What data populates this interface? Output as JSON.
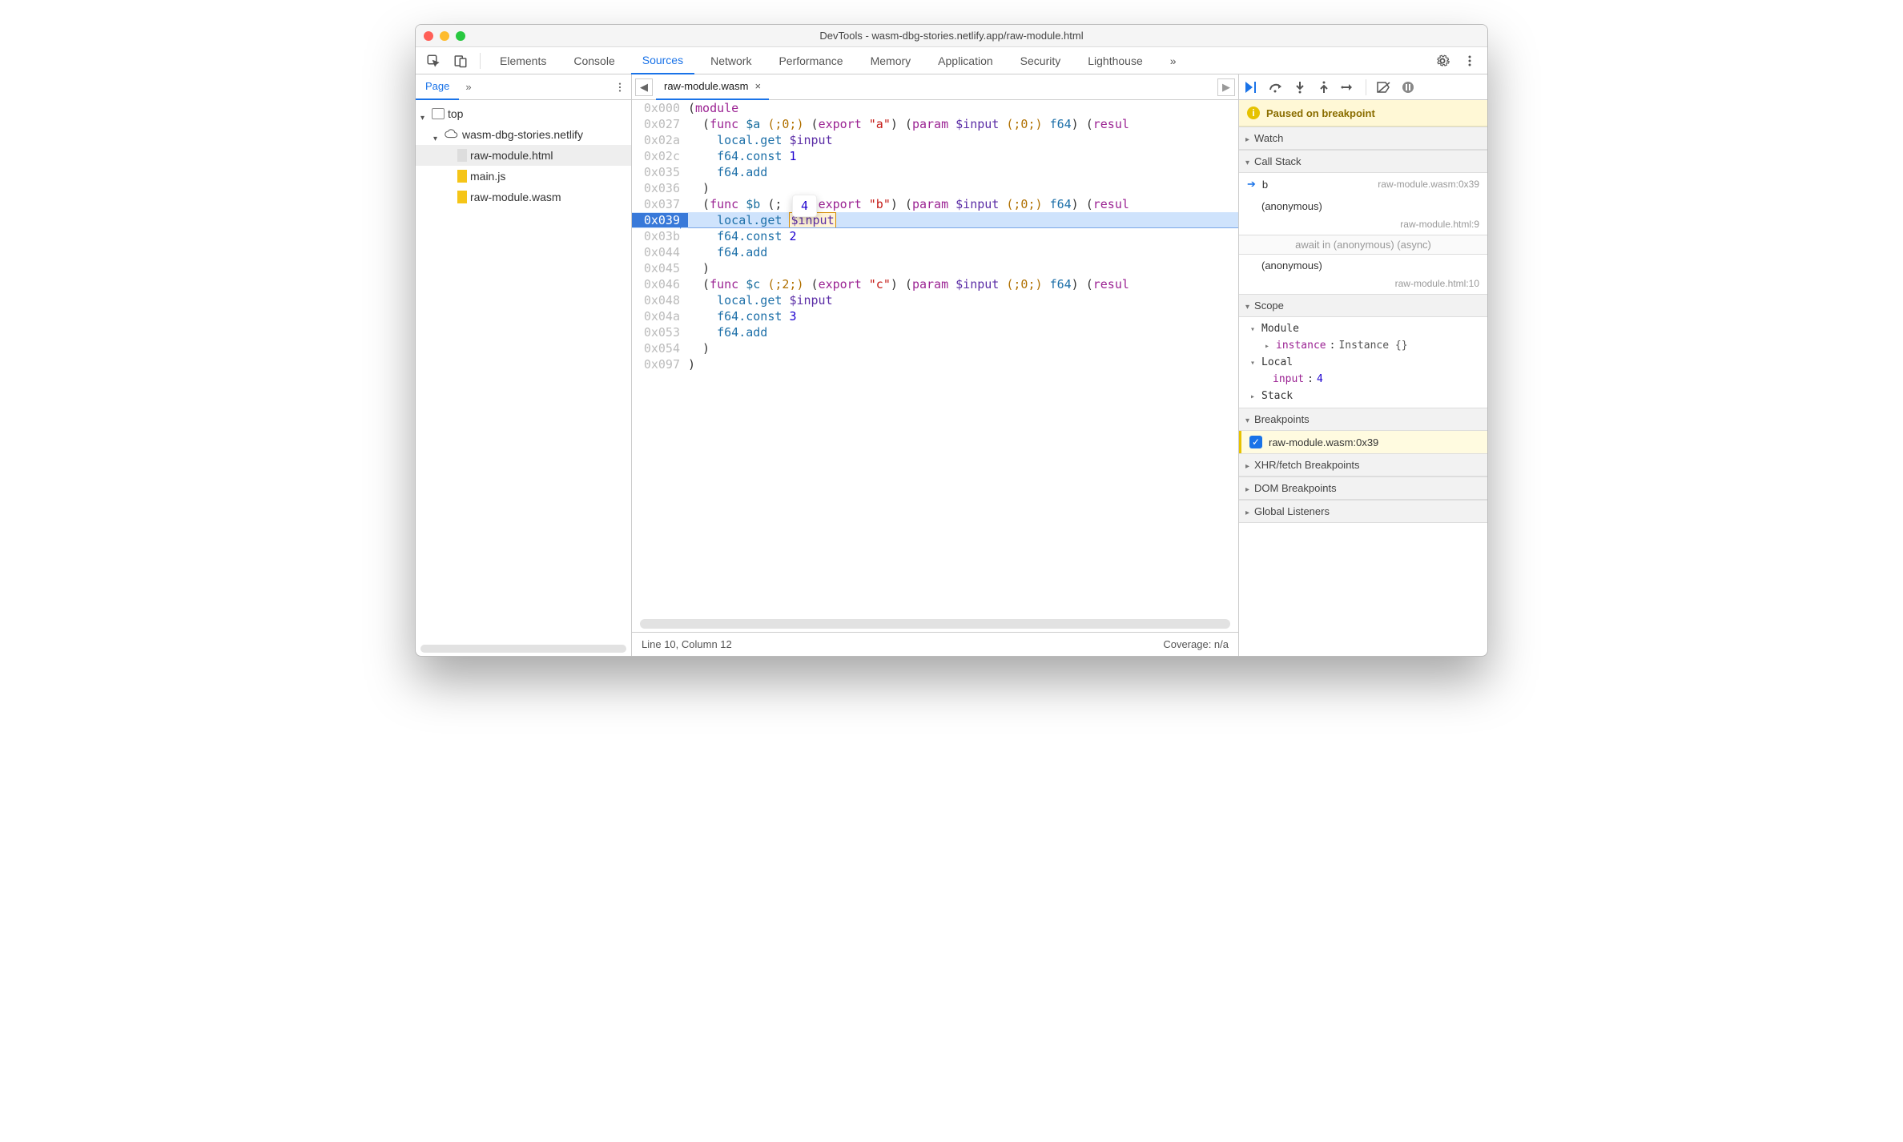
{
  "titlebar": {
    "title": "DevTools - wasm-dbg-stories.netlify.app/raw-module.html"
  },
  "tabs": {
    "items": [
      "Elements",
      "Console",
      "Sources",
      "Network",
      "Performance",
      "Memory",
      "Application",
      "Security",
      "Lighthouse"
    ],
    "more": "»",
    "active_index": 2
  },
  "page_panel": {
    "tabs": {
      "page": "Page",
      "more": "»"
    },
    "tree": {
      "top": "top",
      "origin": "wasm-dbg-stories.netlify",
      "files": [
        "raw-module.html",
        "main.js",
        "raw-module.wasm"
      ],
      "selected_index": 0
    }
  },
  "editor": {
    "tab_label": "raw-module.wasm",
    "tooltip_value": "4",
    "lines": [
      {
        "addr": "0x000",
        "html": "(<span class='kw'>module</span>"
      },
      {
        "addr": "0x027",
        "html": "  (<span class='kw'>func</span> <span class='fn'>$a</span> <span class='cm'>(;0;)</span> (<span class='kw'>export</span> <span class='str'>\"a\"</span>) (<span class='kw'>param</span> <span class='var'>$input</span> <span class='cm'>(;0;)</span> <span class='op'>f64</span>) (<span class='kw'>resul</span>"
      },
      {
        "addr": "0x02a",
        "html": "    <span class='op'>local.get</span> <span class='var'>$input</span>"
      },
      {
        "addr": "0x02c",
        "html": "    <span class='op'>f64.const</span> <span class='num'>1</span>"
      },
      {
        "addr": "0x035",
        "html": "    <span class='op'>f64.add</span>"
      },
      {
        "addr": "0x036",
        "html": "  )"
      },
      {
        "addr": "0x037",
        "html": "  (<span class='kw'>func</span> <span class='fn'>$b</span> (;  ) (<span class='kw'>export</span> <span class='str'>\"b\"</span>) (<span class='kw'>param</span> <span class='var'>$input</span> <span class='cm'>(;0;)</span> <span class='op'>f64</span>) (<span class='kw'>resul</span>"
      },
      {
        "addr": "0x039",
        "html": "    <span class='op'>local.get</span> <span class='tok-box var'>$input</span>",
        "current": true
      },
      {
        "addr": "0x03b",
        "html": "    <span class='op'>f64.const</span> <span class='num'>2</span>"
      },
      {
        "addr": "0x044",
        "html": "    <span class='op'>f64.add</span>"
      },
      {
        "addr": "0x045",
        "html": "  )"
      },
      {
        "addr": "0x046",
        "html": "  (<span class='kw'>func</span> <span class='fn'>$c</span> <span class='cm'>(;2;)</span> (<span class='kw'>export</span> <span class='str'>\"c\"</span>) (<span class='kw'>param</span> <span class='var'>$input</span> <span class='cm'>(;0;)</span> <span class='op'>f64</span>) (<span class='kw'>resul</span>"
      },
      {
        "addr": "0x048",
        "html": "    <span class='op'>local.get</span> <span class='var'>$input</span>"
      },
      {
        "addr": "0x04a",
        "html": "    <span class='op'>f64.const</span> <span class='num'>3</span>"
      },
      {
        "addr": "0x053",
        "html": "    <span class='op'>f64.add</span>"
      },
      {
        "addr": "0x054",
        "html": "  )"
      },
      {
        "addr": "0x097",
        "html": ")"
      }
    ],
    "status_left": "Line 10, Column 12",
    "status_right": "Coverage: n/a"
  },
  "debugger": {
    "paused_msg": "Paused on breakpoint",
    "sections": {
      "watch": "Watch",
      "callstack": "Call Stack",
      "scope": "Scope",
      "breakpoints": "Breakpoints",
      "xhr": "XHR/fetch Breakpoints",
      "dom": "DOM Breakpoints",
      "global": "Global Listeners"
    },
    "callstack": [
      {
        "name": "b",
        "location": "raw-module.wasm:0x39",
        "current": true
      },
      {
        "name": "(anonymous)",
        "location": "raw-module.html:9"
      },
      {
        "async_label": "await in (anonymous) (async)"
      },
      {
        "name": "(anonymous)",
        "location": "raw-module.html:10"
      }
    ],
    "scope": {
      "module": {
        "label": "Module",
        "instance_key": "instance",
        "instance_val": "Instance {}"
      },
      "local": {
        "label": "Local",
        "input_key": "input",
        "input_val": "4"
      },
      "stack": {
        "label": "Stack"
      }
    },
    "breakpoints": [
      {
        "checked": true,
        "label": "raw-module.wasm:0x39"
      }
    ]
  }
}
